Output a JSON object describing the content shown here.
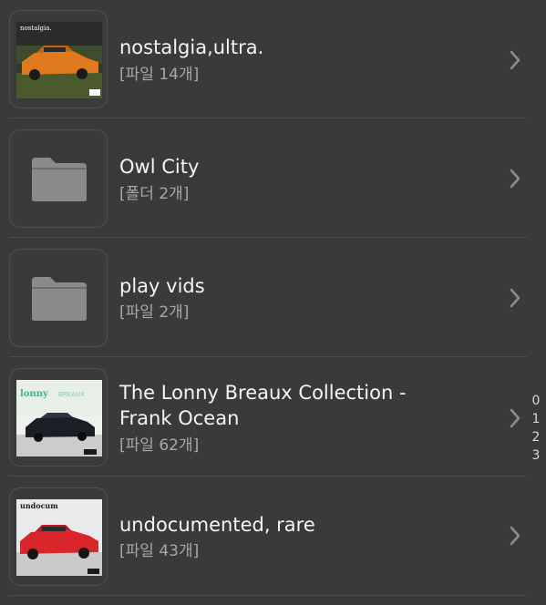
{
  "items": [
    {
      "title": "nostalgia,ultra.",
      "subtitle": "[파일 14개]",
      "thumb": "album-art",
      "art_label": "nostalgia."
    },
    {
      "title": "Owl City",
      "subtitle": "[폴더 2개]",
      "thumb": "folder-icon"
    },
    {
      "title": "play vids",
      "subtitle": "[파일 2개]",
      "thumb": "folder-icon"
    },
    {
      "title_line1": "The Lonny Breaux Collection -",
      "title_line2": "Frank Ocean",
      "subtitle": "[파일 62개]",
      "thumb": "album-art",
      "art_label": "lonny",
      "art_label2": "BREAUX"
    },
    {
      "title": "undocumented, rare",
      "subtitle": "[파일 43개]",
      "thumb": "album-art",
      "art_label": "undocum"
    }
  ],
  "index_bar": [
    "0",
    "1",
    "2",
    "3"
  ],
  "colors": {
    "background": "#3a3a3a",
    "divider": "#4d4d4d",
    "title": "#f4f4f4",
    "subtitle": "#a8a8a8",
    "folder": "#8a8a8a"
  }
}
